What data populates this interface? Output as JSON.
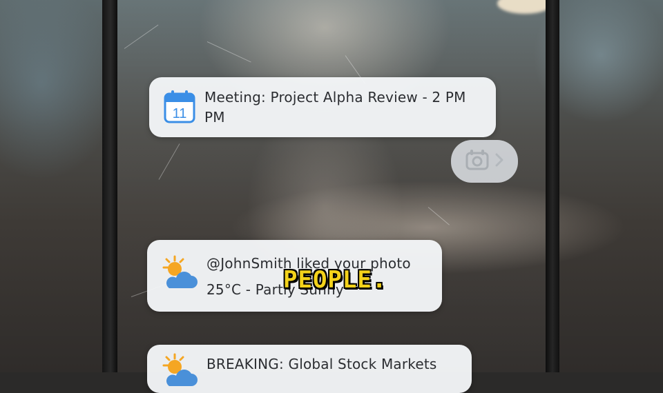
{
  "notifications": [
    {
      "icon": "calendar-icon",
      "calendar_day": "11",
      "title": "Meeting: Project Alpha Review - 2 PM PM"
    },
    {
      "icon": "weather-partly-cloudy-icon",
      "title": "@JohnSmith liked your photo",
      "subtitle": "25°C - Partly Sunny"
    },
    {
      "icon": "weather-partly-cloudy-icon",
      "title": "BREAKING: Global Stock Markets"
    }
  ],
  "mini_pill": {
    "icon": "alarm-icon",
    "chevron": "chevron-right-icon"
  },
  "caption": "PEOPLE.",
  "colors": {
    "card_bg": "#f4f6f8",
    "calendar_blue": "#3a8ee6",
    "sun_orange": "#f5a623",
    "cloud_blue": "#4a90d9",
    "caption_yellow": "#f3d21a"
  }
}
